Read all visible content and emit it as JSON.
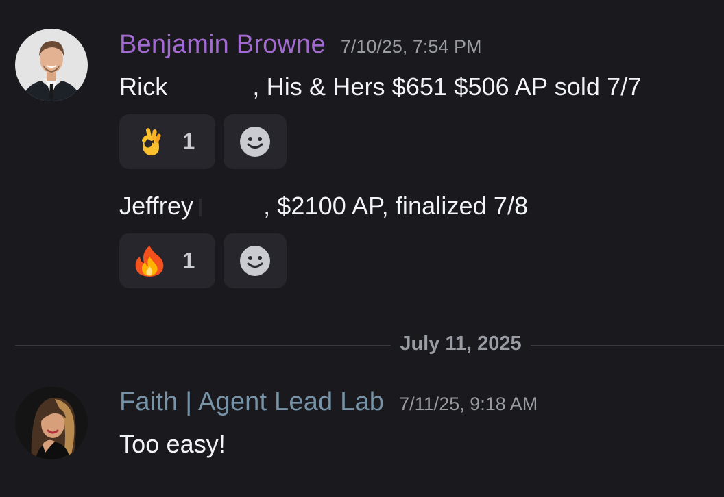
{
  "messages": [
    {
      "username": "Benjamin Browne",
      "timestamp": "7/10/25, 7:54 PM",
      "name_color": "#a26ad1",
      "avatar": "man-in-suit-photo",
      "lines": [
        {
          "text_before": "Rick",
          "text_after": ", His & Hers $651 $506 AP sold 7/7",
          "reactions": [
            {
              "emoji": "ok-hand-emoji",
              "count": "1"
            }
          ]
        },
        {
          "text_before": "Jeffrey",
          "text_after": ", $2100 AP, finalized 7/8",
          "reactions": [
            {
              "emoji": "fire-emoji",
              "count": "1"
            }
          ]
        }
      ]
    },
    {
      "username": "Faith | Agent Lead Lab",
      "timestamp": "7/11/25, 9:18 AM",
      "name_color": "#7793a8",
      "avatar": "woman-photo",
      "text": "Too easy!"
    }
  ],
  "date_divider": "July 11, 2025",
  "add_reaction_icon": "smiley-add-reaction-icon",
  "colors": {
    "background": "#1a191e",
    "reaction_bg": "#27262c",
    "timestamp": "#9a9ca3"
  }
}
